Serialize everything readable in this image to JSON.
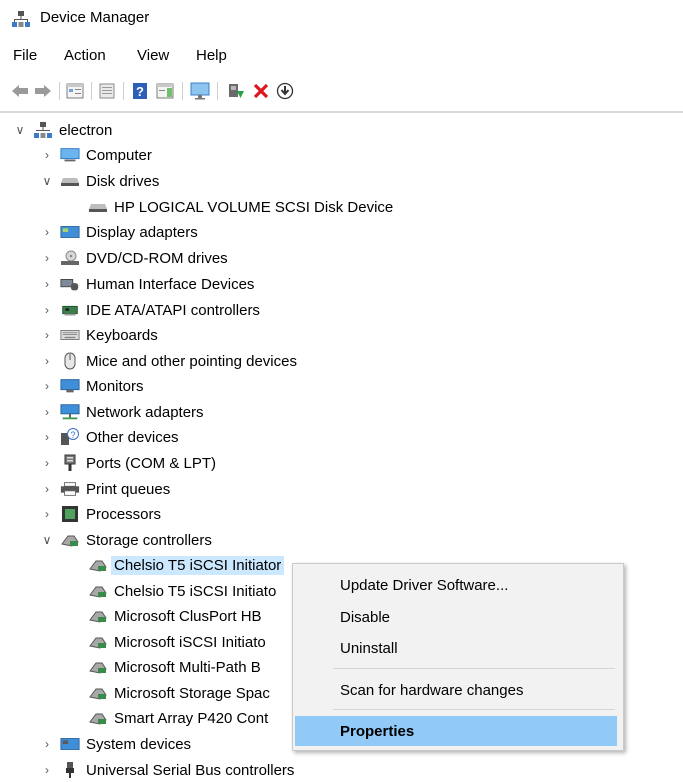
{
  "window": {
    "title": "Device Manager"
  },
  "menu": [
    "File",
    "Action",
    "View",
    "Help"
  ],
  "toolbar_icons": [
    "back-arrow-icon",
    "forward-arrow-icon",
    "properties-view-icon",
    "show-hidden-icon",
    "help-icon",
    "action-pane-icon",
    "monitor-icon",
    "update-driver-icon",
    "uninstall-icon",
    "download-icon"
  ],
  "tree": {
    "root": "electron",
    "categories": [
      {
        "label": "Computer",
        "expanded": false
      },
      {
        "label": "Disk drives",
        "expanded": true,
        "children": [
          "HP LOGICAL VOLUME SCSI Disk Device"
        ]
      },
      {
        "label": "Display adapters",
        "expanded": false
      },
      {
        "label": "DVD/CD-ROM drives",
        "expanded": false
      },
      {
        "label": "Human Interface Devices",
        "expanded": false
      },
      {
        "label": "IDE ATA/ATAPI controllers",
        "expanded": false
      },
      {
        "label": "Keyboards",
        "expanded": false
      },
      {
        "label": "Mice and other pointing devices",
        "expanded": false
      },
      {
        "label": "Monitors",
        "expanded": false
      },
      {
        "label": "Network adapters",
        "expanded": false
      },
      {
        "label": "Other devices",
        "expanded": false
      },
      {
        "label": "Ports (COM & LPT)",
        "expanded": false
      },
      {
        "label": "Print queues",
        "expanded": false
      },
      {
        "label": "Processors",
        "expanded": false
      },
      {
        "label": "Storage controllers",
        "expanded": true,
        "children": [
          "Chelsio T5 iSCSI Initiator",
          "Chelsio T5 iSCSI Initiato",
          "Microsoft ClusPort HB",
          "Microsoft iSCSI Initiato",
          "Microsoft Multi-Path B",
          "Microsoft Storage Spac",
          "Smart Array P420 Cont"
        ]
      },
      {
        "label": "System devices",
        "expanded": false
      },
      {
        "label": "Universal Serial Bus controllers",
        "expanded": false
      }
    ]
  },
  "context_menu": {
    "items": [
      "Update Driver Software...",
      "Disable",
      "Uninstall",
      "Scan for hardware changes",
      "Properties"
    ],
    "highlighted": "Properties"
  }
}
